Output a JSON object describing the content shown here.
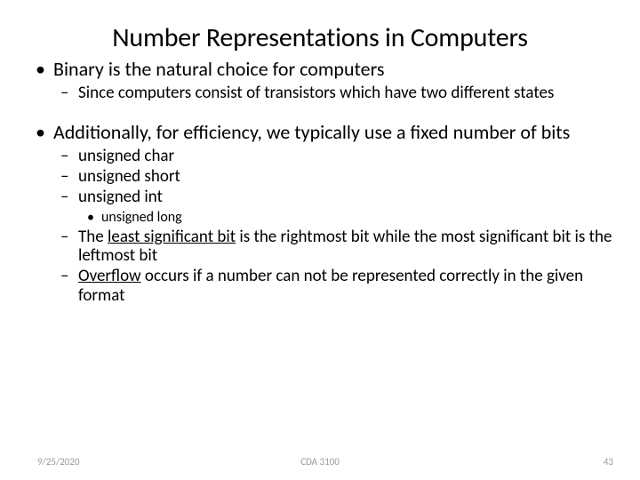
{
  "title": "Number Representations in Computers",
  "bullets": {
    "b1": {
      "text": "Binary is the natural choice for computers",
      "sub": {
        "s1": "Since computers consist of transistors which have two different states"
      }
    },
    "b2": {
      "text": "Additionally, for efficiency, we typically use a fixed number of bits",
      "sub": {
        "s1": "unsigned char",
        "s2": "unsigned short",
        "s3": "unsigned int",
        "s3sub": {
          "t1": "unsigned long"
        },
        "s4a": "The ",
        "s4b": "least significant bit",
        "s4c": " is the rightmost bit while the most significant bit is the leftmost bit",
        "s5a": "Overflow",
        "s5b": " occurs if a number can not be represented correctly in the given format"
      }
    }
  },
  "footer": {
    "date": "9/25/2020",
    "center": "CDA 3100",
    "page": "43"
  }
}
